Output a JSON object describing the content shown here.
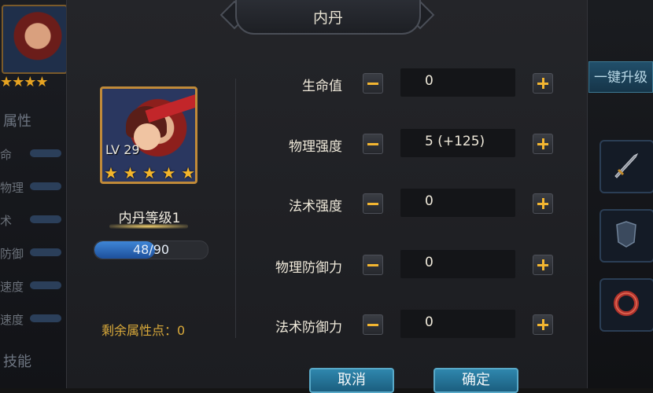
{
  "dialog": {
    "title": "内丹",
    "hero": {
      "level_text": "LV 29",
      "stars": 5
    },
    "neidan_level": "内丹等级1",
    "progress": {
      "text": "48/90",
      "current": 48,
      "max": 90
    },
    "remaining_points": "剩余属性点：0",
    "attributes": [
      {
        "label": "生命值",
        "value": "0"
      },
      {
        "label": "物理强度",
        "value": "5 (+125)"
      },
      {
        "label": "法术强度",
        "value": "0"
      },
      {
        "label": "物理防御力",
        "value": "0"
      },
      {
        "label": "法术防御力",
        "value": "0"
      }
    ],
    "cancel_label": "取消",
    "confirm_label": "确定"
  },
  "background": {
    "left_section_titles": [
      "属性",
      "技能"
    ],
    "left_attr_fragments": [
      "命",
      "物理",
      "术",
      "防御",
      "速度",
      "速度"
    ],
    "right_button_label": "一键升级"
  },
  "colors": {
    "star": "#f3b52b",
    "accent_gold": "#f2b531",
    "button_blue": "#1b5e7f",
    "progress_blue": "#3f86d6"
  },
  "icons": [
    "minus-icon",
    "plus-icon",
    "star-icon",
    "sword-icon",
    "ring-icon"
  ]
}
